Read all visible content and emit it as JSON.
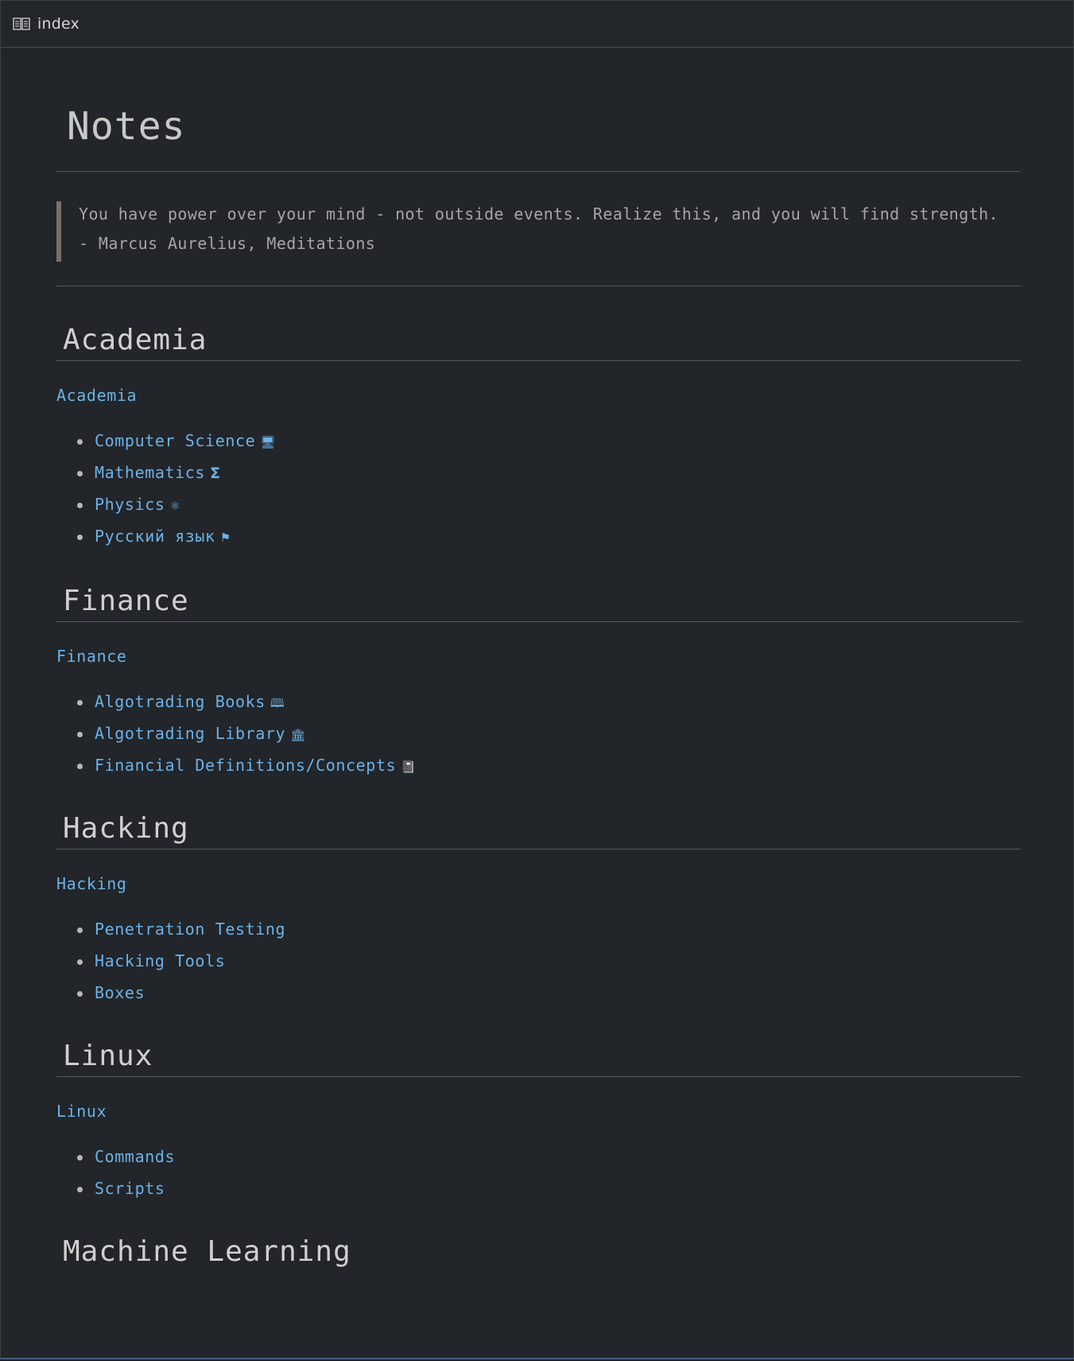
{
  "tab": {
    "icon": "book-icon",
    "title": "index"
  },
  "page": {
    "title": "Notes",
    "quote": {
      "line1": "You have power over your mind - not outside events. Realize this, and you will find strength.",
      "line2": "- Marcus Aurelius, Meditations"
    }
  },
  "sections": [
    {
      "heading": "Academia",
      "link": "Academia",
      "items": [
        {
          "label": "Computer Science",
          "emoji": "🖥"
        },
        {
          "label": "Mathematics",
          "emoji": "Σ"
        },
        {
          "label": "Physics",
          "emoji": "⚛"
        },
        {
          "label": "Русский язык",
          "emoji": "⚑"
        }
      ]
    },
    {
      "heading": "Finance",
      "link": "Finance",
      "items": [
        {
          "label": "Algotrading Books",
          "emoji": "🕮"
        },
        {
          "label": "Algotrading Library",
          "emoji": "🏛"
        },
        {
          "label": "Financial Definitions/Concepts",
          "emoji": "📓"
        }
      ]
    },
    {
      "heading": "Hacking",
      "link": "Hacking",
      "items": [
        {
          "label": "Penetration Testing",
          "emoji": ""
        },
        {
          "label": "Hacking Tools",
          "emoji": ""
        },
        {
          "label": "Boxes",
          "emoji": ""
        }
      ]
    },
    {
      "heading": "Linux",
      "link": "Linux",
      "items": [
        {
          "label": "Commands",
          "emoji": ""
        },
        {
          "label": "Scripts",
          "emoji": ""
        }
      ]
    },
    {
      "heading": "Machine Learning"
    }
  ],
  "colors": {
    "background": "#222529",
    "link": "#6cb2e8",
    "text": "#c9c9c9",
    "quote_bar": "#75706a",
    "rule": "#55585c"
  }
}
